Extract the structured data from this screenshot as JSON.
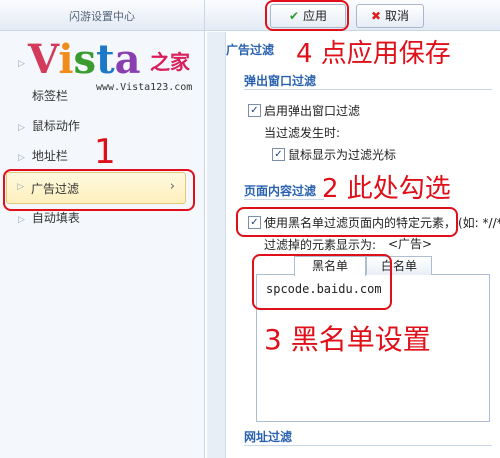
{
  "sidebar": {
    "title": "闪游设置中心",
    "logo": {
      "v": "V",
      "i": "i",
      "s": "s",
      "t": "t",
      "a": "a",
      "cn": "之家",
      "url": "www.Vista123.com"
    },
    "items": [
      {
        "label": "标签栏"
      },
      {
        "label": "鼠标动作"
      },
      {
        "label": "地址栏"
      },
      {
        "label": "广告过滤"
      },
      {
        "label": "自动填表"
      }
    ]
  },
  "toolbar": {
    "apply_label": "应用",
    "cancel_label": "取消"
  },
  "main": {
    "header": "广告过滤",
    "popup_section": {
      "title": "弹出窗口过滤",
      "enable_label": "启用弹出窗口过滤",
      "when_label": "当过滤发生时:",
      "cursor_label": "鼠标显示为过滤光标"
    },
    "content_section": {
      "title": "页面内容过滤",
      "blacklist_label": "使用黑名单过滤页面内的特定元素，",
      "hint": "(如: *//*.",
      "display_label": "过滤掉的元素显示为:",
      "display_value": "<广告>",
      "tabs": [
        "黑名单",
        "白名单"
      ],
      "blacklist_entries": [
        "spcode.baidu.com"
      ]
    },
    "url_section": {
      "title": "网址过滤"
    }
  },
  "annotations": {
    "step1": "1",
    "step2": "2 此处勾选",
    "step3": "3 黑名单设置",
    "step4": "4 点应用保存"
  }
}
